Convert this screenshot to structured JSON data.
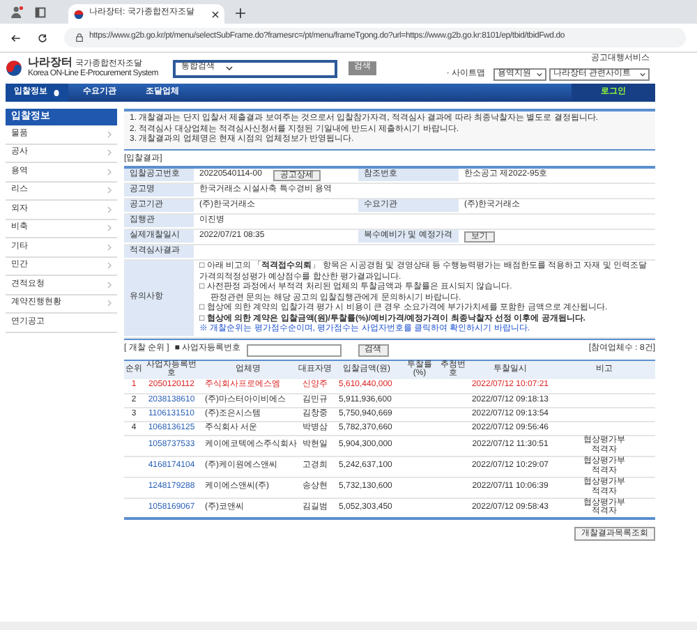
{
  "browser": {
    "tab_title": "나라장터: 국가종합전자조달",
    "url": "https://www.g2b.go.kr/pt/menu/selectSubFrame.do?framesrc=/pt/menu/frameTgong.do?url=https://www.g2b.go.kr:8101/ep/tbid/tbidFwd.do"
  },
  "header": {
    "logo_title": "나라장터",
    "logo_subtitle": "국가종합전자조달",
    "logo_english": "Korea ON-Line E-Procurement System",
    "search_scope": "통합검색",
    "search_button": "검색",
    "top_link": "공고대행서비스",
    "sitemap_label": "· 사이트맵",
    "sitemap_select": "용역지원",
    "related_select": "나라장터 관련사이트"
  },
  "nav": [
    {
      "label": "입찰정보",
      "selected": true
    },
    {
      "label": "수요기관",
      "selected": false
    },
    {
      "label": "조달업체",
      "selected": false
    }
  ],
  "login": "로그인",
  "sidebar": {
    "title": "입찰정보",
    "items": [
      {
        "label": "물품",
        "kind": "submenu"
      },
      {
        "label": "공사",
        "kind": "submenu"
      },
      {
        "label": "용역",
        "kind": "submenu"
      },
      {
        "label": "리스",
        "kind": "submenu"
      },
      {
        "label": "외자",
        "kind": "submenu"
      },
      {
        "label": "비축",
        "kind": "submenu"
      },
      {
        "label": "기타",
        "kind": "submenu"
      },
      {
        "label": "민간",
        "kind": "submenu"
      },
      {
        "label": "견적요청",
        "kind": "submenu"
      },
      {
        "label": "계약진행현황",
        "kind": "submenu"
      },
      {
        "label": "연기공고",
        "kind": "link"
      }
    ]
  },
  "notices": [
    "1. 개찰결과는 단지 입찰서 제출결과 보여주는 것으로서 입찰참가자격, 적격심사 결과에 따라 최종낙찰자는 별도로 결정됩니다.",
    "2. 적격심사 대상업체는 적격심사신청서를 지정된 기일내에 반드시 제출하시기 바랍니다.",
    "3. 개찰결과의 업체명은 현재 시점의 업체정보가 반영됩니다."
  ],
  "bid_result": {
    "title": "[입찰결과]",
    "rows": [
      {
        "kind": "pair",
        "label": "입찰공고번호",
        "value": "20220540114-00",
        "button": "공고상세",
        "label_2": "참조번호",
        "value_2": "한소공고 제2022-95호"
      },
      {
        "kind": "wide",
        "label": "공고명",
        "value": "한국거래소 시설사축 특수경비 용역"
      },
      {
        "kind": "pair",
        "label": "공고기관",
        "value": "(주)한국거래소",
        "label_2": "수요기관",
        "value_2": "(주)한국거래소"
      },
      {
        "kind": "wide",
        "label": "집행관",
        "value": "이진병"
      },
      {
        "kind": "pair",
        "label": "실제개찰일시",
        "value": "2022/07/21 08:35",
        "label_2": "복수예비가 및 예정가격",
        "button_2": "보기"
      },
      {
        "kind": "wide",
        "label": "적격심사결과"
      },
      {
        "kind": "notes",
        "label": "유의사항",
        "lines": [
          {
            "text": "□ 아래 비고의 「**적격접수의뢰**」 항목은 시공경험 및 경영상태 등 수행능력평가는 배점한도를 적용하고 자재 및 인력조달가격의적정성평가 예상점수를 합산한 평가결과입니다.",
            "kind": "plain"
          },
          {
            "text": "□ 사전판정 과정에서 부적격 처리된 업체의 투찰금액과 투찰률은 표시되지 않습니다.",
            "kind": "plain"
          },
          {
            "text": "판정관련 문의는 해당 공고의 입찰집행관에게 문의하시기 바랍니다.",
            "kind": "indent"
          },
          {
            "text": "□ 협상에 의한 계약의 입찰가격 평가 시 비용이 큰 경우 소요가격에 부가가치세를 포함한 금액으로 계산됩니다.",
            "kind": "plain"
          },
          {
            "text": "□ 협상에 의한 계약은 입찰금액(원)/투찰률(%)/예비가격/예정가격이 최종낙찰자 선정 이후에 공개됩니다.",
            "kind": "strong"
          },
          {
            "text": "※ 개찰순위는 평가점수순이며, 평가점수는 사업자번호를 클릭하여 확인하시기 바랍니다.",
            "kind": "info"
          }
        ]
      }
    ]
  },
  "ranking": {
    "title": "[ 개찰 순위 ]",
    "field_label": "■ 사업자등록번호",
    "search_button": "검색",
    "count": "[참여업체수 : 8건]",
    "columns": [
      "순위",
      "사업자등록번호",
      "업체명",
      "대표자명",
      "입찰금액(원)",
      "투찰률(%)",
      "추첨번호",
      "투찰일시",
      "비고"
    ],
    "rows": [
      {
        "rank": "1",
        "biz_no": "2050120112",
        "name": "주식회사프로에스엠",
        "rep": "신양주",
        "amount": "5,610,440,000",
        "time": "2022/07/12 10:07:21",
        "highlighted": true
      },
      {
        "rank": "2",
        "biz_no": "2038138610",
        "name": "(주)마스터아이비에스",
        "rep": "김민규",
        "amount": "5,911,936,600",
        "time": "2022/07/12 09:18:13",
        "highlighted": false
      },
      {
        "rank": "3",
        "biz_no": "1106131510",
        "name": "(주)조은시스템",
        "rep": "김창중",
        "amount": "5,750,940,669",
        "time": "2022/07/12 09:13:54",
        "highlighted": false
      },
      {
        "rank": "4",
        "biz_no": "1068136125",
        "name": "주식회사 서운",
        "rep": "박병삼",
        "amount": "5,782,370,660",
        "time": "2022/07/12 09:56:46",
        "highlighted": false
      },
      {
        "biz_no": "1058737533",
        "name": "케이에코텍에스주식회사",
        "rep": "박현일",
        "amount": "5,904,300,000",
        "time": "2022/07/12 11:30:51",
        "note": "협상평가부적격자",
        "highlighted": false
      },
      {
        "biz_no": "4168174104",
        "name": "(주)케이원에스앤씨",
        "rep": "고경희",
        "amount": "5,242,637,100",
        "time": "2022/07/12 10:29:07",
        "note": "협상평가부적격자",
        "highlighted": false
      },
      {
        "biz_no": "1248179288",
        "name": "케이에스앤씨(주)",
        "rep": "송상현",
        "amount": "5,732,130,600",
        "time": "2022/07/11 10:06:39",
        "note": "협상평가부적격자",
        "highlighted": false
      },
      {
        "biz_no": "1058169067",
        "name": "(주)코앤씨",
        "rep": "김길범",
        "amount": "5,052,303,450",
        "time": "2022/07/12 09:58:43",
        "note": "협상평가부적격자",
        "highlighted": false
      }
    ]
  },
  "footer_button": "개찰결과목록조회"
}
